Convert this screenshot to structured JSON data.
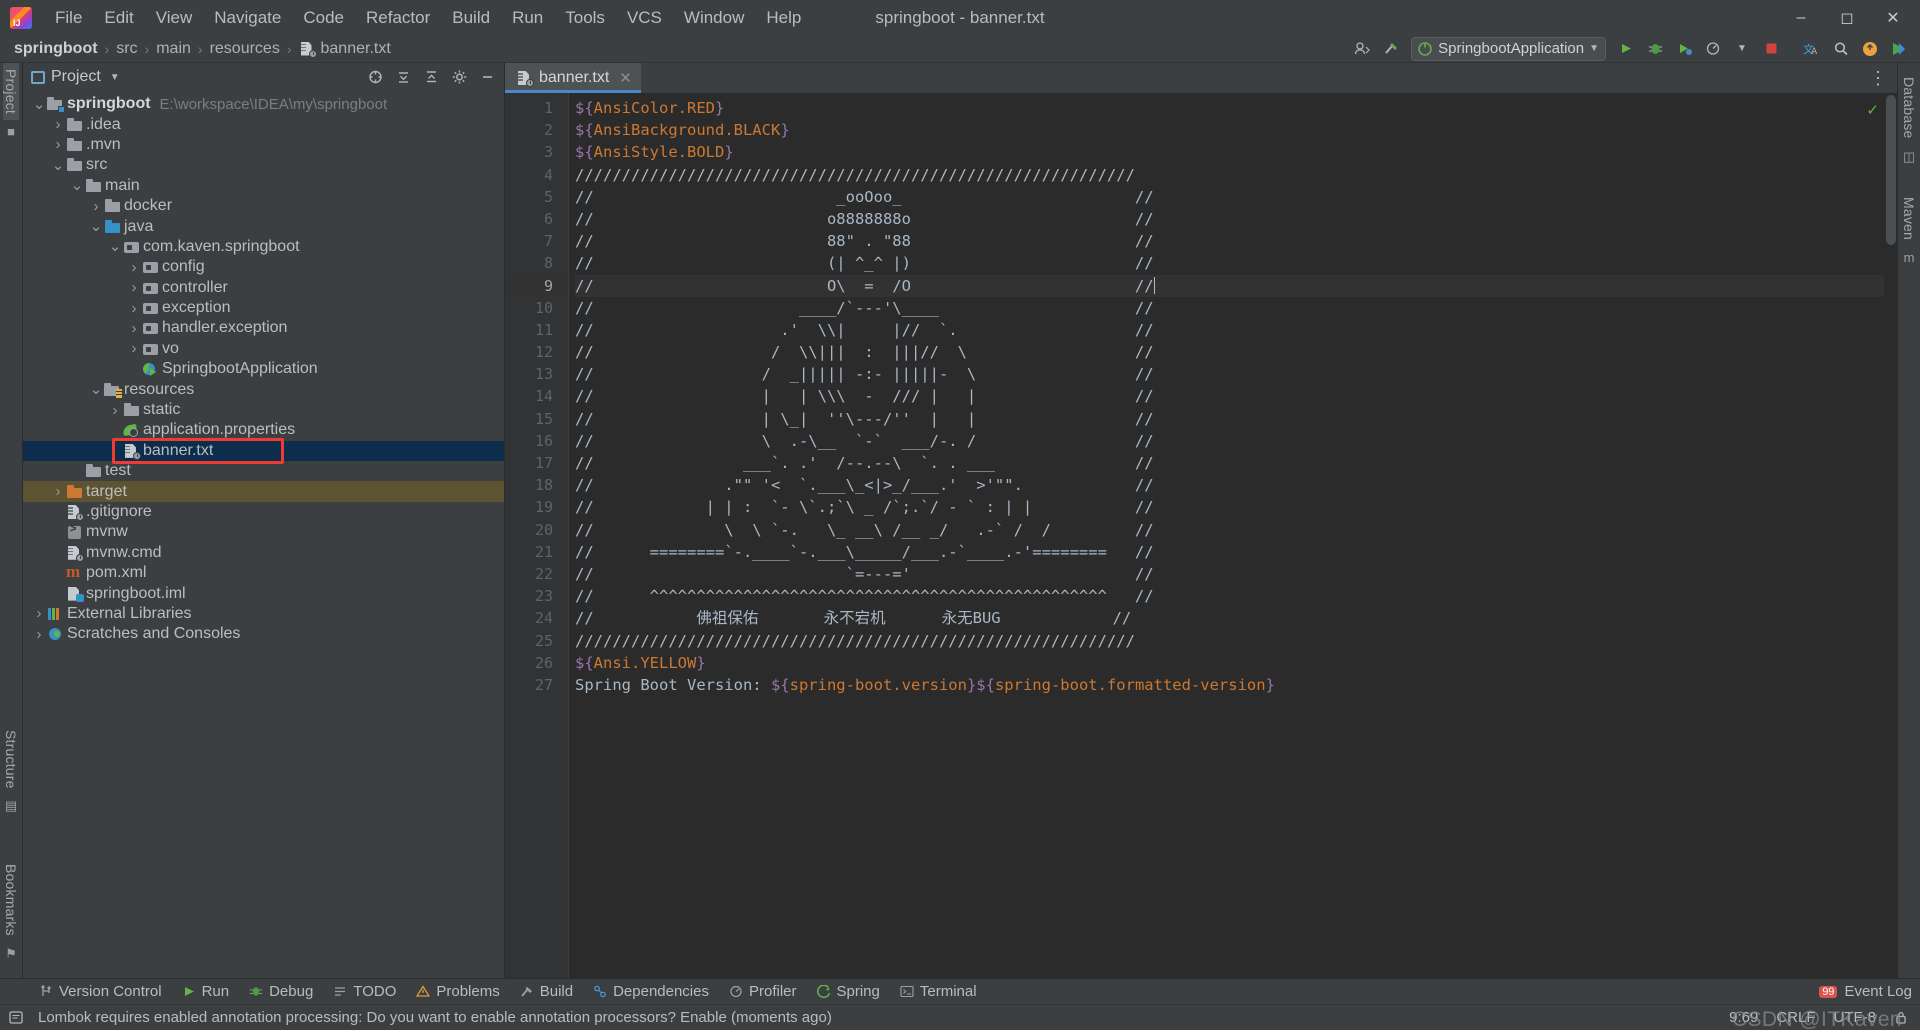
{
  "window": {
    "title": "springboot - banner.txt",
    "logo_icon": "intellij-idea-logo",
    "minimize_icon": "minimize-icon",
    "maximize_icon": "maximize-icon",
    "close_icon": "close-icon"
  },
  "menu": [
    {
      "label": "File"
    },
    {
      "label": "Edit"
    },
    {
      "label": "View"
    },
    {
      "label": "Navigate"
    },
    {
      "label": "Code"
    },
    {
      "label": "Refactor"
    },
    {
      "label": "Build"
    },
    {
      "label": "Run"
    },
    {
      "label": "Tools"
    },
    {
      "label": "VCS"
    },
    {
      "label": "Window"
    },
    {
      "label": "Help"
    }
  ],
  "breadcrumb": {
    "items": [
      "springboot",
      "src",
      "main",
      "resources",
      "banner.txt"
    ],
    "separator": "›"
  },
  "nav_right": {
    "account_icon": "user-account-icon",
    "hammer_icon": "build-hammer-icon",
    "run_config": {
      "label": "SpringbootApplication",
      "icon": "spring-boot-icon",
      "chevron": "chevron-down-icon"
    },
    "run_icon": "run-icon",
    "debug_icon": "debug-icon",
    "run_coverage_icon": "run-with-coverage-icon",
    "profiler_icon": "profiler-icon",
    "stop_icon": "stop-icon",
    "translate_icon": "translate-icon",
    "search_icon": "search-icon",
    "updates_icon": "updates-badge-icon",
    "ide_icon": "ide-icon"
  },
  "left_rail": {
    "items": [
      {
        "label": "Project",
        "active": true
      },
      {
        "label": "Structure",
        "active": false
      },
      {
        "label": "Bookmarks",
        "active": false
      }
    ],
    "favorites_icon": "favorites-icon",
    "structure_icon": "structure-icon",
    "bookmarks_icon": "bookmarks-icon"
  },
  "right_rail": {
    "items": [
      {
        "label": "Database"
      },
      {
        "label": "Maven"
      }
    ]
  },
  "project_panel": {
    "title": "Project",
    "title_chevron": "chevron-down-icon",
    "locate_icon": "select-opened-file-icon",
    "expand_icon": "expand-all-icon",
    "collapse_icon": "collapse-all-icon",
    "settings_icon": "gear-icon",
    "hide_icon": "hide-icon",
    "tree": [
      {
        "label": "springboot",
        "path": "E:\\workspace\\IDEA\\my\\springboot",
        "indent": 0,
        "arrow": "down",
        "icon": "module-folder-icon",
        "bold": true
      },
      {
        "label": ".idea",
        "indent": 1,
        "arrow": "right",
        "icon": "folder-icon"
      },
      {
        "label": ".mvn",
        "indent": 1,
        "arrow": "right",
        "icon": "folder-icon"
      },
      {
        "label": "src",
        "indent": 1,
        "arrow": "down",
        "icon": "folder-icon"
      },
      {
        "label": "main",
        "indent": 2,
        "arrow": "down",
        "icon": "folder-icon"
      },
      {
        "label": "docker",
        "indent": 3,
        "arrow": "right",
        "icon": "folder-icon"
      },
      {
        "label": "java",
        "indent": 3,
        "arrow": "down",
        "icon": "source-folder-icon"
      },
      {
        "label": "com.kaven.springboot",
        "indent": 4,
        "arrow": "down",
        "icon": "package-icon"
      },
      {
        "label": "config",
        "indent": 5,
        "arrow": "right",
        "icon": "package-icon"
      },
      {
        "label": "controller",
        "indent": 5,
        "arrow": "right",
        "icon": "package-icon"
      },
      {
        "label": "exception",
        "indent": 5,
        "arrow": "right",
        "icon": "package-icon"
      },
      {
        "label": "handler.exception",
        "indent": 5,
        "arrow": "right",
        "icon": "package-icon"
      },
      {
        "label": "vo",
        "indent": 5,
        "arrow": "right",
        "icon": "package-icon"
      },
      {
        "label": "SpringbootApplication",
        "indent": 5,
        "arrow": "none",
        "icon": "spring-application-class-icon"
      },
      {
        "label": "resources",
        "indent": 3,
        "arrow": "down",
        "icon": "resources-folder-icon"
      },
      {
        "label": "static",
        "indent": 4,
        "arrow": "right",
        "icon": "folder-icon"
      },
      {
        "label": "application.properties",
        "indent": 4,
        "arrow": "none",
        "icon": "spring-properties-icon"
      },
      {
        "label": "banner.txt",
        "indent": 4,
        "arrow": "none",
        "icon": "text-file-icon",
        "selected": true,
        "highlighted": true
      },
      {
        "label": "test",
        "indent": 2,
        "arrow": "none",
        "icon": "folder-icon"
      },
      {
        "label": "target",
        "indent": 1,
        "arrow": "right",
        "icon": "excluded-folder-icon",
        "target": true
      },
      {
        "label": ".gitignore",
        "indent": 1,
        "arrow": "none",
        "icon": "text-file-icon"
      },
      {
        "label": "mvnw",
        "indent": 1,
        "arrow": "none",
        "icon": "shell-script-icon"
      },
      {
        "label": "mvnw.cmd",
        "indent": 1,
        "arrow": "none",
        "icon": "text-file-icon"
      },
      {
        "label": "pom.xml",
        "indent": 1,
        "arrow": "none",
        "icon": "maven-xml-icon"
      },
      {
        "label": "springboot.iml",
        "indent": 1,
        "arrow": "none",
        "icon": "iml-file-icon"
      },
      {
        "label": "External Libraries",
        "indent": 0,
        "arrow": "right",
        "icon": "libraries-icon"
      },
      {
        "label": "Scratches and Consoles",
        "indent": 0,
        "arrow": "right",
        "icon": "scratches-icon"
      }
    ]
  },
  "editor": {
    "tabs": [
      {
        "label": "banner.txt",
        "icon": "text-file-icon",
        "active": true,
        "close_icon": "close-icon"
      }
    ],
    "tab_options_icon": "more-options-icon",
    "inspection_ok_icon": "inspections-ok-icon",
    "current_line": 9,
    "lines": [
      {
        "n": 1,
        "segments": [
          {
            "t": "${",
            "c": "brace"
          },
          {
            "t": "AnsiColor.RED",
            "c": "prop"
          },
          {
            "t": "}",
            "c": "brace"
          }
        ]
      },
      {
        "n": 2,
        "segments": [
          {
            "t": "${",
            "c": "brace"
          },
          {
            "t": "AnsiBackground.BLACK",
            "c": "prop"
          },
          {
            "t": "}",
            "c": "brace"
          }
        ]
      },
      {
        "n": 3,
        "segments": [
          {
            "t": "${",
            "c": "brace"
          },
          {
            "t": "AnsiStyle.BOLD",
            "c": "prop"
          },
          {
            "t": "}",
            "c": "brace"
          }
        ]
      },
      {
        "n": 4,
        "segments": [
          {
            "t": "////////////////////////////////////////////////////////////",
            "c": "txt"
          }
        ]
      },
      {
        "n": 5,
        "segments": [
          {
            "t": "//                          _ooOoo_                         //",
            "c": "txt"
          }
        ]
      },
      {
        "n": 6,
        "segments": [
          {
            "t": "//                         o8888888o                        //",
            "c": "txt"
          }
        ]
      },
      {
        "n": 7,
        "segments": [
          {
            "t": "//                         88\" . \"88                        //",
            "c": "txt"
          }
        ]
      },
      {
        "n": 8,
        "segments": [
          {
            "t": "//                         (| ^_^ |)                        //",
            "c": "txt"
          }
        ]
      },
      {
        "n": 9,
        "segments": [
          {
            "t": "//                         O\\  =  /O                        //",
            "c": "txt"
          }
        ],
        "caret_after": true
      },
      {
        "n": 10,
        "segments": [
          {
            "t": "//                      ____/`---'\\____                     //",
            "c": "txt"
          }
        ]
      },
      {
        "n": 11,
        "segments": [
          {
            "t": "//                    .'  \\\\|     |//  `.                   //",
            "c": "txt"
          }
        ]
      },
      {
        "n": 12,
        "segments": [
          {
            "t": "//                   /  \\\\|||  :  |||//  \\                  //",
            "c": "txt"
          }
        ]
      },
      {
        "n": 13,
        "segments": [
          {
            "t": "//                  /  _||||| -:- |||||-  \\                 //",
            "c": "txt"
          }
        ]
      },
      {
        "n": 14,
        "segments": [
          {
            "t": "//                  |   | \\\\\\  -  /// |   |                 //",
            "c": "txt"
          }
        ]
      },
      {
        "n": 15,
        "segments": [
          {
            "t": "//                  | \\_|  ''\\---/''  |   |                 //",
            "c": "txt"
          }
        ]
      },
      {
        "n": 16,
        "segments": [
          {
            "t": "//                  \\  .-\\__  `-`  ___/-. /                 //",
            "c": "txt"
          }
        ]
      },
      {
        "n": 17,
        "segments": [
          {
            "t": "//                ___`. .'  /--.--\\  `. . ___               //",
            "c": "txt"
          }
        ]
      },
      {
        "n": 18,
        "segments": [
          {
            "t": "//              .\"\" '<  `.___\\_<|>_/___.'  >'\"\".            //",
            "c": "txt"
          }
        ]
      },
      {
        "n": 19,
        "segments": [
          {
            "t": "//            | | :  `- \\`.;`\\ _ /`;.`/ - ` : | |           //",
            "c": "txt"
          }
        ]
      },
      {
        "n": 20,
        "segments": [
          {
            "t": "//              \\  \\ `-.   \\_ __\\ /__ _/   .-` /  /         //",
            "c": "txt"
          }
        ]
      },
      {
        "n": 21,
        "segments": [
          {
            "t": "//      ========`-.____`-.___\\_____/___.-`____.-'========   //",
            "c": "txt"
          }
        ]
      },
      {
        "n": 22,
        "segments": [
          {
            "t": "//                           `=---='                        //",
            "c": "txt"
          }
        ]
      },
      {
        "n": 23,
        "segments": [
          {
            "t": "//      ^^^^^^^^^^^^^^^^^^^^^^^^^^^^^^^^^^^^^^^^^^^^^^^^^   //",
            "c": "txt"
          }
        ]
      },
      {
        "n": 24,
        "segments": [
          {
            "t": "//           佛祖保佑       永不宕机      永无BUG            //",
            "c": "txt"
          }
        ]
      },
      {
        "n": 25,
        "segments": [
          {
            "t": "////////////////////////////////////////////////////////////",
            "c": "txt"
          }
        ]
      },
      {
        "n": 26,
        "segments": [
          {
            "t": "${",
            "c": "brace"
          },
          {
            "t": "Ansi.YELLOW",
            "c": "prop"
          },
          {
            "t": "}",
            "c": "brace"
          }
        ]
      },
      {
        "n": 27,
        "segments": [
          {
            "t": "Spring Boot Version: ",
            "c": "txt"
          },
          {
            "t": "${",
            "c": "brace"
          },
          {
            "t": "spring-boot.version",
            "c": "prop"
          },
          {
            "t": "}",
            "c": "brace"
          },
          {
            "t": "${",
            "c": "brace"
          },
          {
            "t": "spring-boot.formatted-version",
            "c": "prop"
          },
          {
            "t": "}",
            "c": "brace"
          }
        ]
      }
    ]
  },
  "bottom_bar": {
    "items": [
      {
        "label": "Version Control",
        "icon": "version-control-icon"
      },
      {
        "label": "Run",
        "icon": "run-icon"
      },
      {
        "label": "Debug",
        "icon": "debug-icon"
      },
      {
        "label": "TODO",
        "icon": "todo-icon"
      },
      {
        "label": "Problems",
        "icon": "problems-icon"
      },
      {
        "label": "Build",
        "icon": "build-hammer-icon"
      },
      {
        "label": "Dependencies",
        "icon": "dependencies-icon"
      },
      {
        "label": "Profiler",
        "icon": "profiler-icon"
      },
      {
        "label": "Spring",
        "icon": "spring-icon"
      },
      {
        "label": "Terminal",
        "icon": "terminal-icon"
      }
    ],
    "event_log": {
      "label": "Event Log",
      "icon": "event-log-icon",
      "badge": "99"
    }
  },
  "status_bar": {
    "icon": "notification-icon",
    "message": "Lombok requires enabled annotation processing: Do you want to enable annotation processors? Enable (moments ago)",
    "caret_position": "9:69",
    "line_separator": "CRLF",
    "encoding": "UTF-8",
    "watermark": "CSDN @ITKaven"
  },
  "colors": {
    "accent_blue": "#4a88c7",
    "selection": "#0d2d4d",
    "highlight_red": "#ee3b33",
    "target_folder": "#5c5333",
    "editor_bg": "#2b2b2b",
    "panel_bg": "#3c3f41",
    "property_orange": "#cc7832",
    "brace_purple": "#9876aa",
    "text_default": "#a9b7c6"
  }
}
